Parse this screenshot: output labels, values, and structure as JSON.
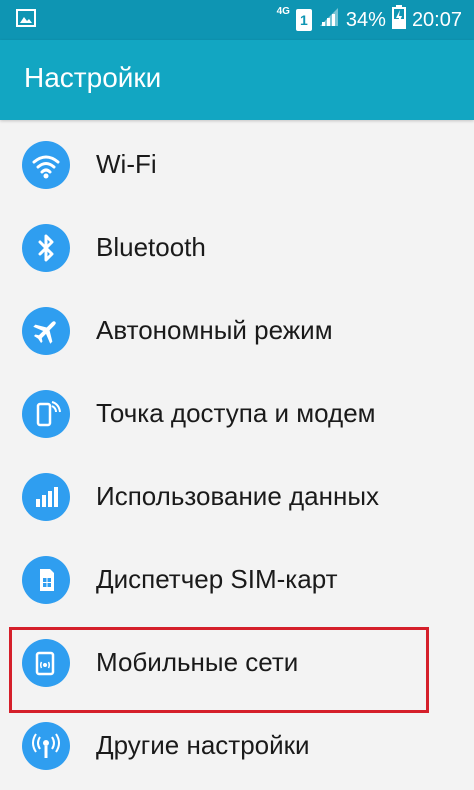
{
  "status_bar": {
    "network": "4G",
    "sim": "1",
    "battery": "34%",
    "time": "20:07",
    "icons": [
      "gallery-notification-icon",
      "signal-icon",
      "battery-charging-icon"
    ]
  },
  "header": {
    "title": "Настройки"
  },
  "menu": {
    "items": [
      {
        "label": "Wi-Fi",
        "icon": "wifi-icon"
      },
      {
        "label": "Bluetooth",
        "icon": "bluetooth-icon"
      },
      {
        "label": "Автономный режим",
        "icon": "airplane-icon"
      },
      {
        "label": "Точка доступа и модем",
        "icon": "hotspot-icon"
      },
      {
        "label": "Использование данных",
        "icon": "data-usage-icon"
      },
      {
        "label": "Диспетчер SIM-карт",
        "icon": "sim-card-icon"
      },
      {
        "label": "Мобильные сети",
        "icon": "mobile-networks-icon"
      },
      {
        "label": "Другие настройки",
        "icon": "other-settings-icon"
      }
    ]
  },
  "colors": {
    "status_bar": "#0e95b3",
    "title_bar": "#12a6c2",
    "icon_circle": "#2f9ef0",
    "highlight": "#d51f2a",
    "background": "#f3f3f3"
  }
}
